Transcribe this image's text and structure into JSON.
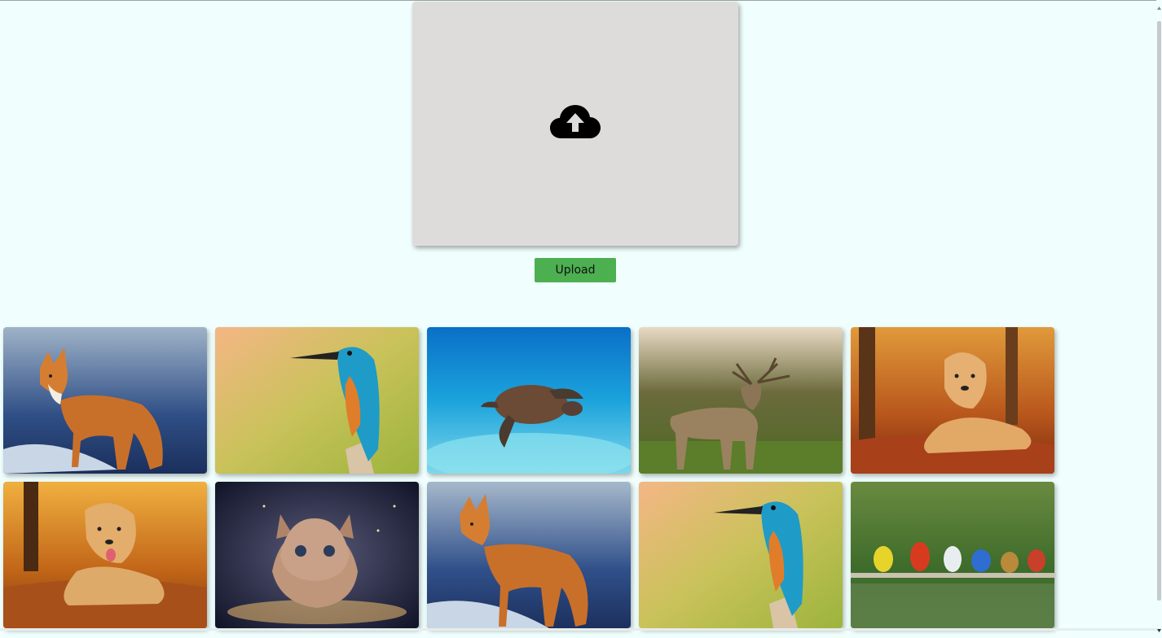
{
  "upload": {
    "icon": "cloud-upload-icon",
    "button_label": "Upload"
  },
  "gallery": {
    "images": [
      {
        "subject": "fox"
      },
      {
        "subject": "kingfisher"
      },
      {
        "subject": "sea-turtle"
      },
      {
        "subject": "deer"
      },
      {
        "subject": "golden-retriever"
      },
      {
        "subject": "golden-retriever"
      },
      {
        "subject": "kitten"
      },
      {
        "subject": "fox"
      },
      {
        "subject": "kingfisher"
      },
      {
        "subject": "birds-on-branch"
      }
    ]
  },
  "colors": {
    "page_bg": "#f0fffe",
    "dropzone_bg": "#dedcdb",
    "button_bg": "#4caf50"
  }
}
